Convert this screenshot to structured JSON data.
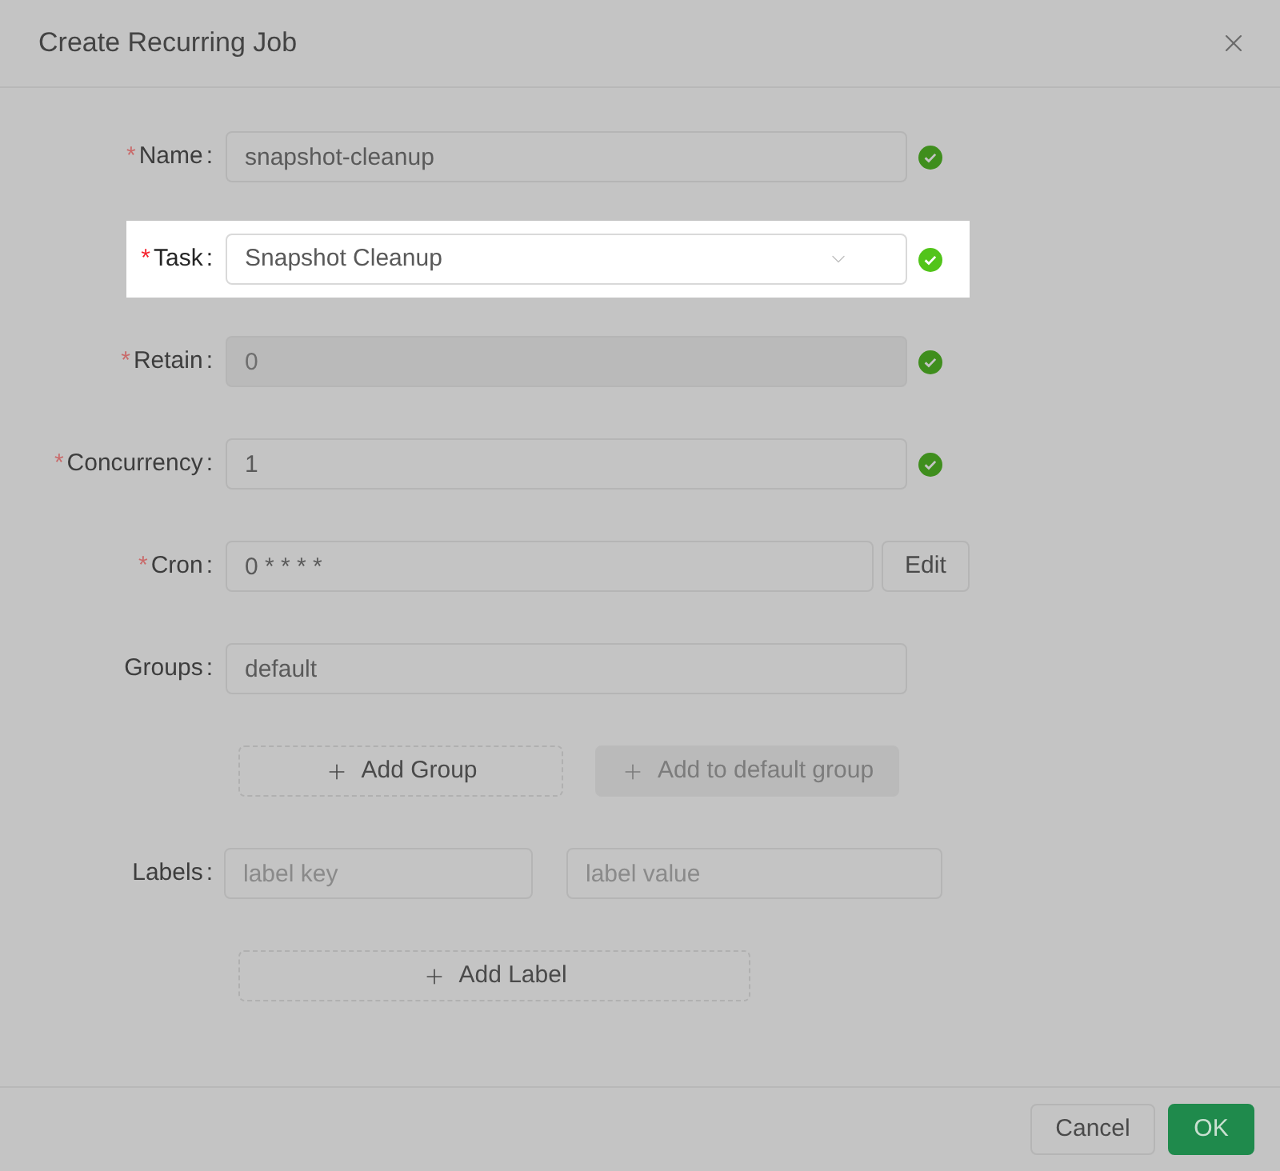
{
  "dialog": {
    "title": "Create Recurring Job"
  },
  "fields": [
    {
      "kind": "input",
      "asterisk": "*",
      "label": "Name",
      "colon": ":",
      "value": "snapshot-cleanup",
      "disabled": false,
      "valid": true,
      "highlighted": false
    },
    {
      "kind": "select",
      "asterisk": "*",
      "label": "Task",
      "colon": ":",
      "value": "Snapshot Cleanup",
      "disabled": false,
      "valid": true,
      "highlighted": true
    },
    {
      "kind": "input",
      "asterisk": "*",
      "label": "Retain",
      "colon": ":",
      "value": "0",
      "disabled": true,
      "valid": true,
      "highlighted": false
    },
    {
      "kind": "input",
      "asterisk": "*",
      "label": "Concurrency",
      "colon": ":",
      "value": "1",
      "disabled": false,
      "valid": true,
      "highlighted": false
    },
    {
      "kind": "input-button",
      "asterisk": "*",
      "label": "Cron",
      "colon": ":",
      "value": "0 * * * *",
      "button": "Edit",
      "disabled": false,
      "valid": false,
      "highlighted": false
    },
    {
      "kind": "input",
      "label": "Groups",
      "colon": ":",
      "value": "default",
      "disabled": false,
      "valid": false,
      "highlighted": false
    },
    {
      "kind": "buttons",
      "buttons": [
        {
          "label": "Add Group",
          "disabled": false
        },
        {
          "label": "Add to default group",
          "disabled": true
        }
      ]
    },
    {
      "kind": "pair",
      "label": "Labels",
      "colon": ":",
      "key_placeholder": "label key",
      "value_placeholder": "label value",
      "highlighted": false
    },
    {
      "kind": "add",
      "button": "Add Label"
    }
  ],
  "footer": {
    "buttons": [
      {
        "label": "Cancel",
        "kind": "default"
      },
      {
        "label": "OK",
        "kind": "primary"
      }
    ]
  }
}
